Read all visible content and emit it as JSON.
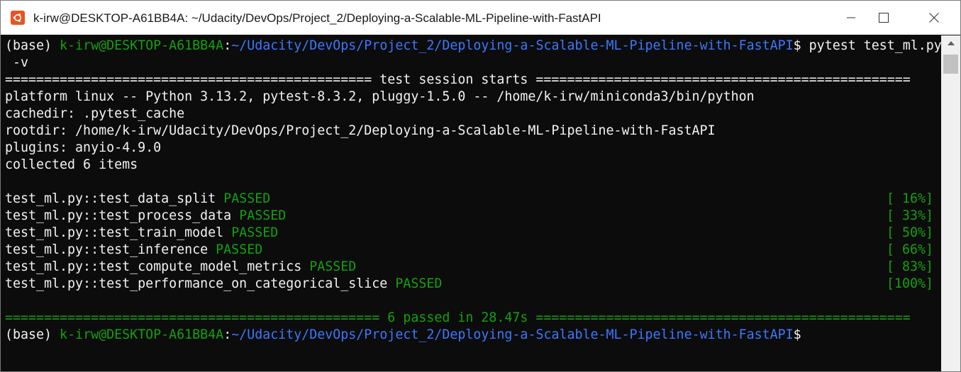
{
  "window": {
    "title": "k-irw@DESKTOP-A61BB4A: ~/Udacity/DevOps/Project_2/Deploying-a-Scalable-ML-Pipeline-with-FastAPI",
    "icon": "ubuntu-icon",
    "controls": [
      "minimize-icon",
      "maximize-icon",
      "close-icon"
    ]
  },
  "terminal": {
    "prompt1": {
      "env": "(base) ",
      "user_host": "k-irw@DESKTOP-A61BB4A",
      "sep": ":",
      "path": "~/Udacity/DevOps/Project_2/Deploying-a-Scalable-ML-Pipeline-with-FastAPI",
      "dollar": "$",
      "command": " pytest test_ml.py",
      "command_wrap": " -v"
    },
    "session_header": "=============================================== test session starts ================================================",
    "platform": "platform linux -- Python 3.13.2, pytest-8.3.2, pluggy-1.5.0 -- /home/k-irw/miniconda3/bin/python",
    "cachedir": "cachedir: .pytest_cache",
    "rootdir": "rootdir: /home/k-irw/Udacity/DevOps/Project_2/Deploying-a-Scalable-ML-Pipeline-with-FastAPI",
    "plugins": "plugins: anyio-4.9.0",
    "collected": "collected 6 items",
    "tests": [
      {
        "name": "test_ml.py::test_data_split ",
        "status": "PASSED",
        "progress": "[ 16%]"
      },
      {
        "name": "test_ml.py::test_process_data ",
        "status": "PASSED",
        "progress": "[ 33%]"
      },
      {
        "name": "test_ml.py::test_train_model ",
        "status": "PASSED",
        "progress": "[ 50%]"
      },
      {
        "name": "test_ml.py::test_inference ",
        "status": "PASSED",
        "progress": "[ 66%]"
      },
      {
        "name": "test_ml.py::test_compute_model_metrics ",
        "status": "PASSED",
        "progress": "[ 83%]"
      },
      {
        "name": "test_ml.py::test_performance_on_categorical_slice ",
        "status": "PASSED",
        "progress": "[100%]"
      }
    ],
    "summary": "================================================ 6 passed in 28.47s ================================================",
    "prompt2": {
      "env": "(base) ",
      "user_host": "k-irw@DESKTOP-A61BB4A",
      "sep": ":",
      "path": "~/Udacity/DevOps/Project_2/Deploying-a-Scalable-ML-Pipeline-with-FastAPI",
      "dollar": "$"
    }
  },
  "colors": {
    "background": "#0c0c0c",
    "text": "#cccccc",
    "green": "#13a10e",
    "blue": "#3b78ff",
    "ubuntu_orange": "#e95420"
  }
}
